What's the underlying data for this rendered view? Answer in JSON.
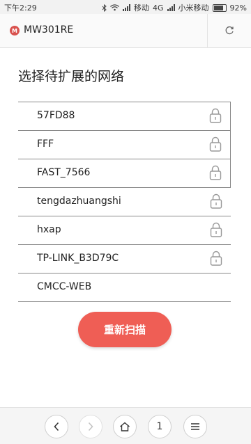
{
  "status_bar": {
    "time": "下午2:29",
    "carrier1": "移动",
    "network_type": "4G",
    "carrier2": "小米移动",
    "battery": "92%"
  },
  "browser": {
    "site_icon_letter": "M",
    "title": "MW301RE"
  },
  "page": {
    "heading": "选择待扩展的网络",
    "networks": [
      {
        "name": "57FD88",
        "locked": true
      },
      {
        "name": "FFF",
        "locked": true
      },
      {
        "name": "FAST_7566",
        "locked": true
      },
      {
        "name": "tengdazhuangshi",
        "locked": true
      },
      {
        "name": "hxap",
        "locked": true
      },
      {
        "name": "TP-LINK_B3D79C",
        "locked": true
      },
      {
        "name": "CMCC-WEB",
        "locked": false
      }
    ],
    "rescan_label": "重新扫描"
  },
  "bottom_nav": {
    "tab_count": "1"
  },
  "colors": {
    "accent": "#ef5e55",
    "site_icon": "#d9534f"
  }
}
